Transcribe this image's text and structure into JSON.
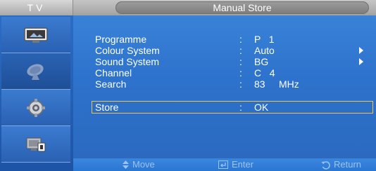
{
  "sidebar": {
    "title": "TV",
    "items": [
      {
        "icon": "tv-picture-icon"
      },
      {
        "icon": "satellite-dish-icon",
        "active": true
      },
      {
        "icon": "gear-icon"
      },
      {
        "icon": "input-source-icon"
      }
    ]
  },
  "header": {
    "title": "Manual Store"
  },
  "rows": [
    {
      "label": "Programme",
      "colon": ":",
      "value": "P   1",
      "has_arrow": false
    },
    {
      "label": "Colour System",
      "colon": ":",
      "value": "Auto",
      "has_arrow": true
    },
    {
      "label": "Sound System",
      "colon": ":",
      "value": "BG",
      "has_arrow": true
    },
    {
      "label": "Channel",
      "colon": ":",
      "value": "C   4",
      "has_arrow": false
    },
    {
      "label": "Search",
      "colon": ":",
      "value": "83     MHz",
      "has_arrow": false
    },
    {
      "label": "Store",
      "colon": ":",
      "value": "OK",
      "has_arrow": false,
      "selected": true
    }
  ],
  "footer": {
    "move": "Move",
    "enter": "Enter",
    "return": "Return"
  },
  "colors": {
    "highlight_border": "#f0c34a",
    "menu_blue": "#2d72cc",
    "hint_text": "#9cc3ef"
  }
}
